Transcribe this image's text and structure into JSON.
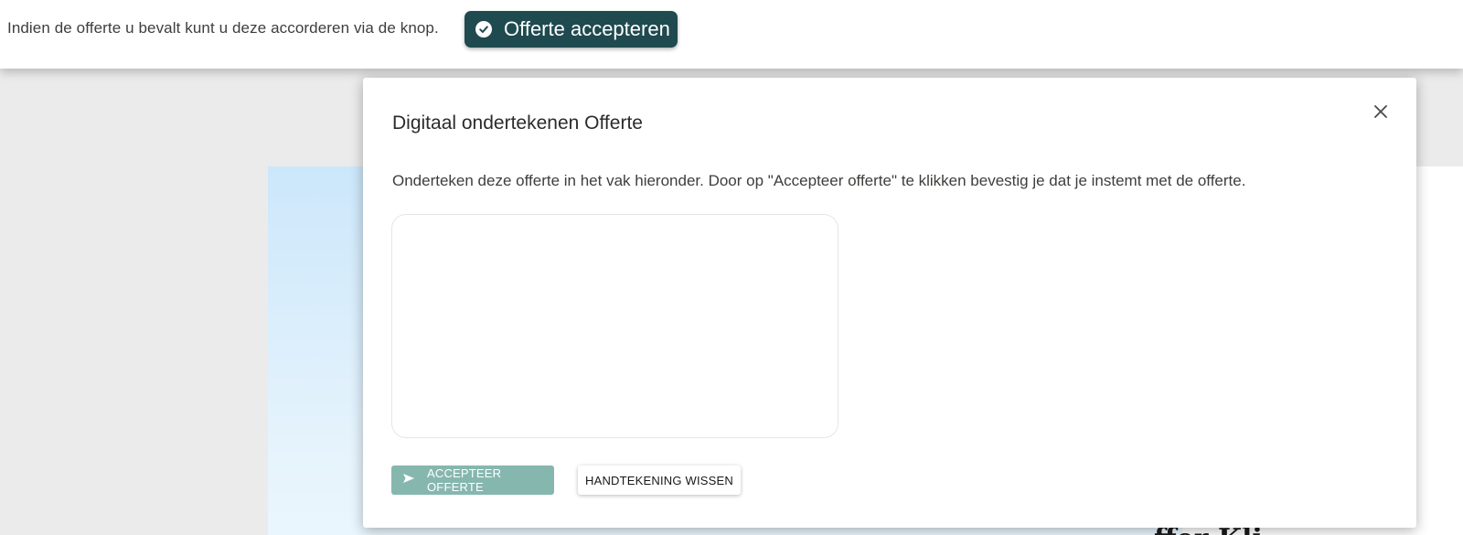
{
  "topbar": {
    "text": "Indien de offerte u bevalt kunt u deze accorderen via de knop.",
    "accept_button": "Offerte accepteren"
  },
  "background": {
    "heading_fragment": "ffer Kli"
  },
  "modal": {
    "title": "Digitaal ondertekenen Offerte",
    "description": "Onderteken deze offerte in het vak hieronder. Door op \"Accepteer offerte\" te klikken bevestig je dat je instemt met de offerte.",
    "accept_button": "ACCEPTEER OFFERTE",
    "clear_button": "HANDTEKENING WISSEN"
  },
  "icons": {
    "top_button": "check-circle-icon",
    "accept_button": "send-icon",
    "close": "close-icon"
  },
  "colors": {
    "primary_dark": "#1f4a4f",
    "accept_disabled": "#86b7af",
    "panel_light_blue": "#cce7fb"
  }
}
